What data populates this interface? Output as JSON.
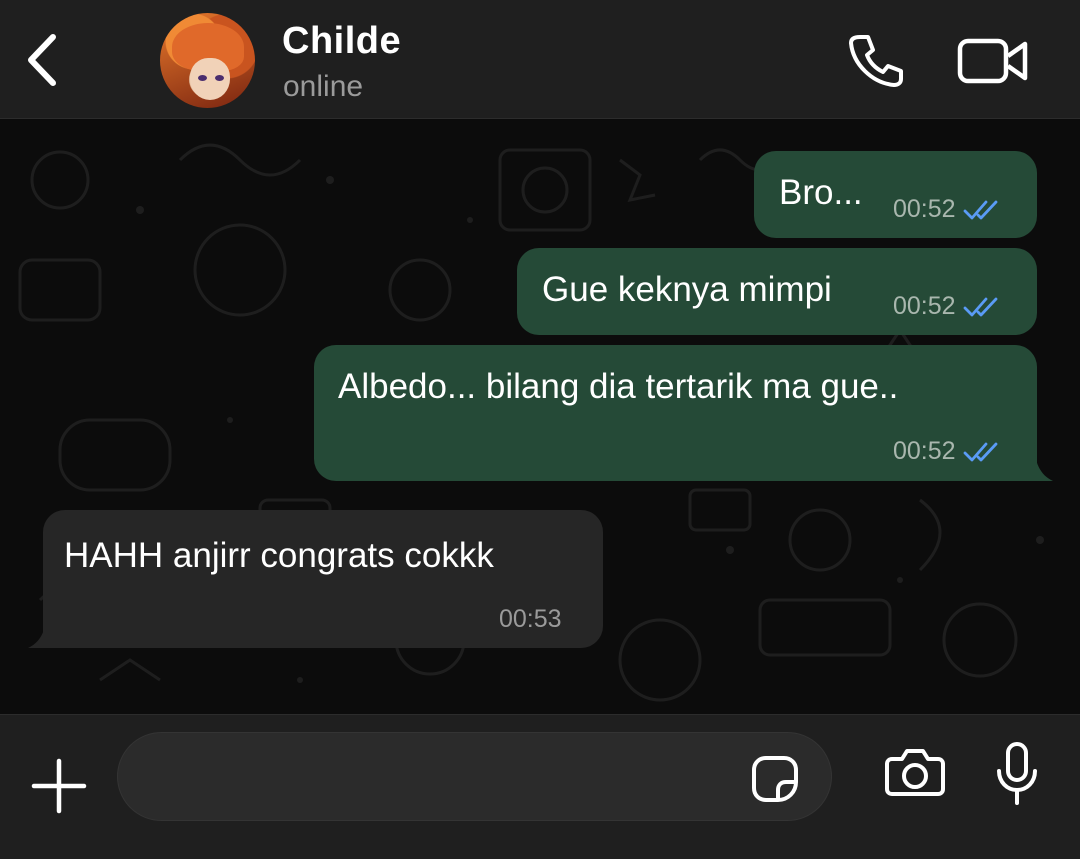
{
  "header": {
    "contact_name": "Childe",
    "status": "online",
    "icons": [
      "back-chevron-icon",
      "phone-icon",
      "video-camera-icon"
    ]
  },
  "messages": [
    {
      "direction": "outgoing",
      "text": "Bro...",
      "time": "00:52",
      "read": true
    },
    {
      "direction": "outgoing",
      "text": "Gue keknya mimpi",
      "time": "00:52",
      "read": true
    },
    {
      "direction": "outgoing",
      "text": "Albedo... bilang dia tertarik ma gue..",
      "time": "00:52",
      "read": true
    },
    {
      "direction": "incoming",
      "text": "HAHH anjirr congrats cokkk",
      "time": "00:53",
      "read": false
    }
  ],
  "composer": {
    "input_value": "",
    "input_placeholder": "",
    "icons": [
      "plus-icon",
      "sticker-icon",
      "camera-icon",
      "microphone-icon"
    ]
  },
  "colors": {
    "outgoing_bubble": "#254a37",
    "incoming_bubble": "#262626",
    "read_ticks": "#5a9bf5",
    "header_bg": "#1f1f1f"
  }
}
